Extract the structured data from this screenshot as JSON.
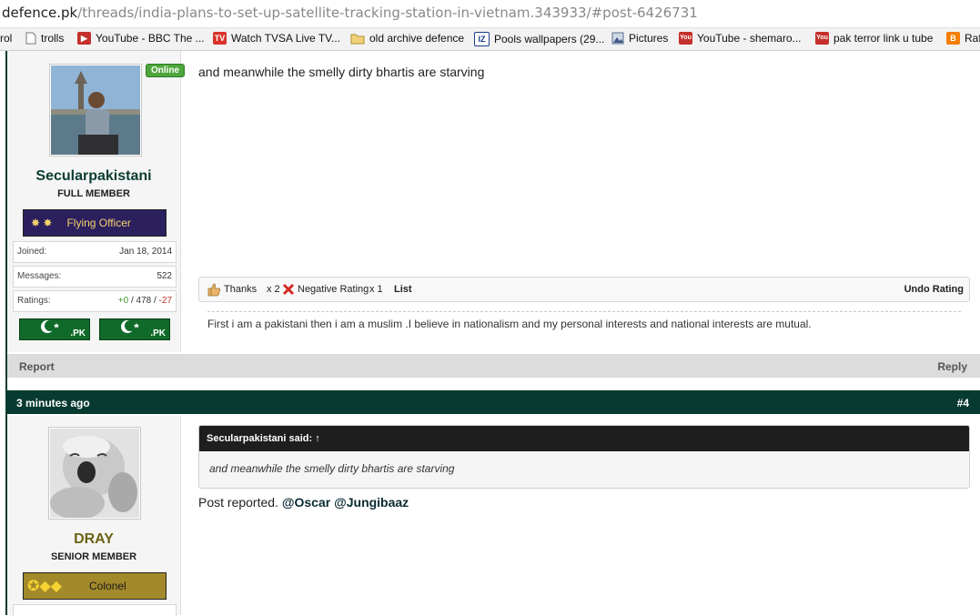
{
  "browser": {
    "url_domain": "defence.pk",
    "url_path": "/threads/india-plans-to-set-up-satellite-tracking-station-in-vietnam.343933/#post-6426731",
    "bookmarks": [
      {
        "label": "rol",
        "icon": "none"
      },
      {
        "label": "trolls",
        "icon": "page-icon"
      },
      {
        "label": "YouTube - BBC The ...",
        "icon": "youtube-icon"
      },
      {
        "label": "Watch TVSA Live TV...",
        "icon": "tv-icon"
      },
      {
        "label": "old archive defence",
        "icon": "folder-icon"
      },
      {
        "label": "Pools wallpapers (29...",
        "icon": "iz-icon"
      },
      {
        "label": "Pictures",
        "icon": "pictures-icon"
      },
      {
        "label": "YouTube - shemaro...",
        "icon": "youtube-icon"
      },
      {
        "label": "pak terror link u tube",
        "icon": "youtube-icon"
      },
      {
        "label": "Raf",
        "icon": "blogger-icon"
      }
    ]
  },
  "post1": {
    "author": "Secularpakistani",
    "author_color": "#0b3d33",
    "member_title": "FULL MEMBER",
    "online_badge": "Online",
    "rank": "Flying Officer",
    "stats": [
      {
        "label": "Joined:",
        "value": "Jan 18, 2014"
      },
      {
        "label": "Messages:",
        "value": "522"
      }
    ],
    "ratings_label": "Ratings:",
    "ratings_pos": "+0",
    "ratings_sep1": " / ",
    "ratings_neutral": "478",
    "ratings_sep2": " / ",
    "ratings_neg": "-27",
    "flag_text": ".PK",
    "message": "and meanwhile the smelly dirty bhartis are starving",
    "thanks": "Thanks",
    "thanks_count": "x 2",
    "negative": "Negative Rating",
    "negative_count": "x 1",
    "list": "List",
    "undo": "Undo Rating",
    "signature": "First i am a pakistani then i am a muslim .I believe in nationalism and my personal interests and national interests are mutual.",
    "report": "Report",
    "reply": "Reply"
  },
  "post2": {
    "time": "3 minutes ago",
    "number": "#4",
    "author": "DRAY",
    "author_color": "#6b6415",
    "member_title": "SENIOR MEMBER",
    "rank": "Colonel",
    "quote_header": "Secularpakistani said:",
    "quote_arrow": "↑",
    "quote_body": "and meanwhile the smelly dirty bhartis are starving",
    "message_prefix": "Post reported. ",
    "mention1": "@Oscar",
    "mention2": "@Jungibaaz"
  }
}
